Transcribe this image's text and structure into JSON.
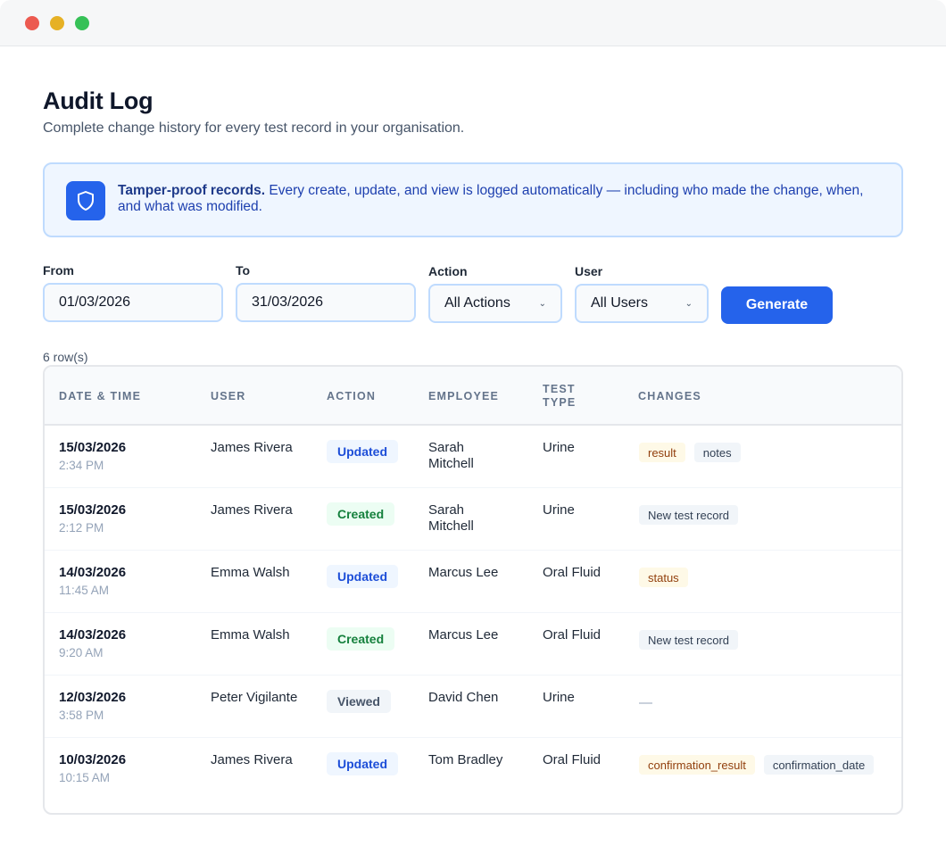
{
  "window": {
    "buttons": [
      "close",
      "minimize",
      "zoom"
    ]
  },
  "header": {
    "title": "Audit Log",
    "subtitle": "Complete change history for every test record in your organisation."
  },
  "banner": {
    "icon": "shield-icon",
    "strong": "Tamper-proof records.",
    "text": " Every create, update, and view is logged automatically — including who made the change, when, and what was modified."
  },
  "filters": {
    "from_label": "From",
    "from_value": "01/03/2026",
    "to_label": "To",
    "to_value": "31/03/2026",
    "action_label": "Action",
    "action_value": "All Actions",
    "user_label": "User",
    "user_value": "All Users",
    "generate_label": "Generate"
  },
  "table": {
    "row_count": "6 row(s)",
    "columns": [
      "DATE & TIME",
      "USER",
      "ACTION",
      "EMPLOYEE",
      "TEST\nTYPE",
      "CHANGES"
    ],
    "rows": [
      {
        "date": "15/03/2026",
        "time": "2:34 PM",
        "user": "James Rivera",
        "action": "Updated",
        "employee": "Sarah Mitchell",
        "test_type": "Urine",
        "changes": [
          "result",
          "notes"
        ]
      },
      {
        "date": "15/03/2026",
        "time": "2:12 PM",
        "user": "James Rivera",
        "action": "Created",
        "employee": "Sarah Mitchell",
        "test_type": "Urine",
        "changes": [
          "New test record"
        ]
      },
      {
        "date": "14/03/2026",
        "time": "11:45 AM",
        "user": "Emma Walsh",
        "action": "Updated",
        "employee": "Marcus Lee",
        "test_type": "Oral Fluid",
        "changes": [
          "status"
        ]
      },
      {
        "date": "14/03/2026",
        "time": "9:20 AM",
        "user": "Emma Walsh",
        "action": "Created",
        "employee": "Marcus Lee",
        "test_type": "Oral Fluid",
        "changes": [
          "New test record"
        ]
      },
      {
        "date": "12/03/2026",
        "time": "3:58 PM",
        "user": "Peter Vigilante",
        "action": "Viewed",
        "employee": "David Chen",
        "test_type": "Urine",
        "changes": [
          "—"
        ]
      },
      {
        "date": "10/03/2026",
        "time": "10:15 AM",
        "user": "James Rivera",
        "action": "Updated",
        "employee": "Tom Bradley",
        "test_type": "Oral Fluid",
        "changes": [
          "confirmation_result",
          "confirmation_date"
        ]
      }
    ]
  },
  "colors": {
    "accent": "#2563eb",
    "banner_bg": "#eff6ff",
    "updated": "#1d4ed8",
    "created": "#15803d",
    "viewed": "#475569",
    "field_chip": "#92400e"
  }
}
